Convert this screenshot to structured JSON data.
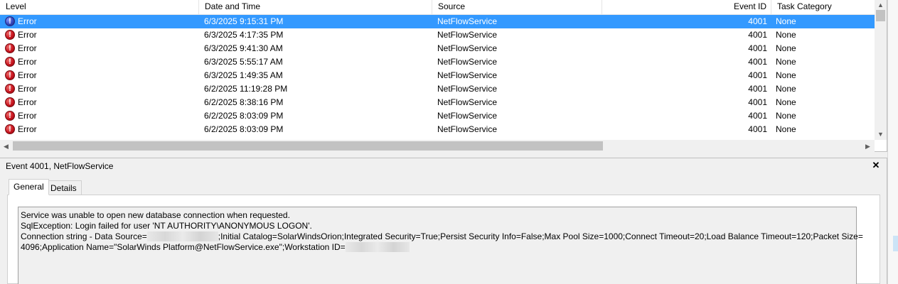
{
  "columns": {
    "level": "Level",
    "date_time": "Date and Time",
    "source": "Source",
    "event_id": "Event ID",
    "task_category": "Task Category"
  },
  "events": [
    {
      "level": "Error",
      "date_time": "6/3/2025 9:15:31 PM",
      "source": "NetFlowService",
      "event_id": "4001",
      "task_category": "None",
      "selected": true
    },
    {
      "level": "Error",
      "date_time": "6/3/2025 4:17:35 PM",
      "source": "NetFlowService",
      "event_id": "4001",
      "task_category": "None"
    },
    {
      "level": "Error",
      "date_time": "6/3/2025 9:41:30 AM",
      "source": "NetFlowService",
      "event_id": "4001",
      "task_category": "None"
    },
    {
      "level": "Error",
      "date_time": "6/3/2025 5:55:17 AM",
      "source": "NetFlowService",
      "event_id": "4001",
      "task_category": "None"
    },
    {
      "level": "Error",
      "date_time": "6/3/2025 1:49:35 AM",
      "source": "NetFlowService",
      "event_id": "4001",
      "task_category": "None"
    },
    {
      "level": "Error",
      "date_time": "6/2/2025 11:19:28 PM",
      "source": "NetFlowService",
      "event_id": "4001",
      "task_category": "None"
    },
    {
      "level": "Error",
      "date_time": "6/2/2025 8:38:16 PM",
      "source": "NetFlowService",
      "event_id": "4001",
      "task_category": "None"
    },
    {
      "level": "Error",
      "date_time": "6/2/2025 8:03:09 PM",
      "source": "NetFlowService",
      "event_id": "4001",
      "task_category": "None"
    },
    {
      "level": "Error",
      "date_time": "6/2/2025 8:03:09 PM",
      "source": "NetFlowService",
      "event_id": "4001",
      "task_category": "None"
    }
  ],
  "detail": {
    "title": "Event 4001, NetFlowService",
    "close_glyph": "✕",
    "tabs": [
      "General",
      "Details"
    ],
    "message": {
      "line1": "Service was unable to open new database connection when requested.",
      "line2": "SqlException: Login failed for user 'NT AUTHORITY\\ANONYMOUS LOGON'.",
      "line3_prefix": "Connection string - Data Source=",
      "line3_suffix": ";Initial Catalog=SolarWindsOrion;Integrated Security=True;Persist Security Info=False;Max Pool Size=1000;Connect Timeout=20;Load Balance Timeout=120;Packet Size=",
      "line4_prefix": "4096;Application Name=\"SolarWinds Platform@NetFlowService.exe\";Workstation ID="
    }
  },
  "scroll": {
    "up": "▲",
    "down": "▼",
    "left": "◀",
    "right": "▶"
  }
}
